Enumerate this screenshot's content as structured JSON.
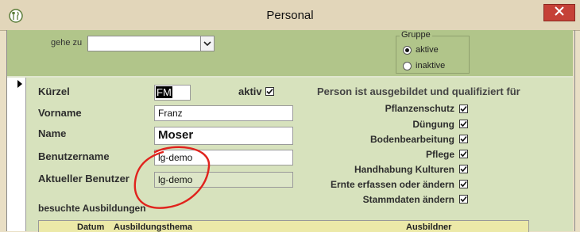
{
  "window": {
    "title": "Personal",
    "app_icon": "cutlery-icon",
    "close_icon": "close-icon"
  },
  "header": {
    "goto_label": "gehe zu",
    "goto_value": "",
    "group": {
      "title": "Gruppe",
      "options": [
        {
          "label": "aktive",
          "selected": true
        },
        {
          "label": "inaktive",
          "selected": false
        }
      ]
    }
  },
  "form": {
    "kuerzel_label": "Kürzel",
    "kuerzel_value": "FM",
    "aktiv_label": "aktiv",
    "aktiv_checked": true,
    "vorname_label": "Vorname",
    "vorname_value": "Franz",
    "name_label": "Name",
    "name_value": "Moser",
    "benutzername_label": "Benutzername",
    "benutzername_value": "lg-demo",
    "aktueller_benutzer_label": "Aktueller Benutzer",
    "aktueller_benutzer_value": "lg-demo",
    "ausbildungen_label": "besuchte Ausbildungen"
  },
  "qualifications": {
    "heading": "Person ist ausgebildet und qualifiziert für",
    "items": [
      {
        "label": "Pflanzenschutz",
        "checked": true
      },
      {
        "label": "Düngung",
        "checked": true
      },
      {
        "label": "Bodenbearbeitung",
        "checked": true
      },
      {
        "label": "Pflege",
        "checked": true
      },
      {
        "label": "Handhabung Kulturen",
        "checked": true
      },
      {
        "label": "Ernte erfassen oder ändern",
        "checked": true
      },
      {
        "label": "Stammdaten ändern",
        "checked": true
      }
    ]
  },
  "grid": {
    "columns": [
      "Datum",
      "Ausbildungsthema",
      "Ausbildner"
    ]
  },
  "colors": {
    "header_band": "#b1c58a",
    "detail_bg": "#d7e2bd",
    "close_button": "#c54137",
    "annotation": "#e0231d"
  }
}
